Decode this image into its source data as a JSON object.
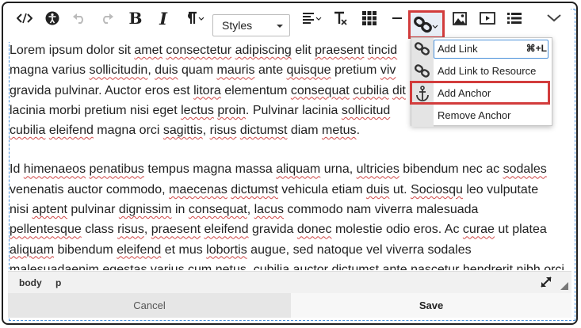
{
  "toolbar": {
    "styles_label": "Styles",
    "icons": [
      "source-code-icon",
      "accessibility-icon",
      "undo-icon",
      "redo-icon",
      "bold-icon",
      "italic-icon",
      "paragraph-icon",
      "align-icon",
      "clear-format-icon",
      "table-icon",
      "horizontal-rule-icon",
      "link-icon",
      "image-icon",
      "media-icon",
      "list-icon",
      "chevron-down-icon"
    ]
  },
  "link_menu": {
    "items": [
      {
        "label": "Add Link",
        "shortcut": "⌘+L"
      },
      {
        "label": "Add Link to Resource"
      },
      {
        "label": "Add Anchor"
      },
      {
        "label": "Remove Anchor"
      }
    ]
  },
  "content": {
    "paragraph_1": [
      "Lorem ipsum dolor sit ",
      "amet",
      " ",
      "consectetur",
      " ",
      "adipiscing",
      " elit ",
      "praesent",
      " ",
      "tincid",
      "magna varius ",
      "sollicitudin",
      ", ",
      "duis",
      " quam ",
      "mauris",
      " ante ",
      "quisque",
      " pretium ",
      "viv",
      "gravida pulvinar. Auctor eros est ",
      "litora",
      " elementum ",
      "consequat",
      " ",
      "cubilia",
      " ",
      "dit",
      "lacinia morbi pretium nisi eget ",
      "lectus",
      " ",
      "proin",
      ". Pulvinar lacinia ",
      "sollicitud",
      "cubilia",
      " ",
      "eleifend",
      " magna orci ",
      "sagittis",
      ", ",
      "risus",
      " ",
      "dictumst",
      " diam ",
      "metus",
      "."
    ],
    "paragraph_2": [
      "Id ",
      "himenaeos",
      " ",
      "penatibus",
      " tempus magna massa ",
      "aliquam",
      " urna, ",
      "ultricies",
      " bibendum nec ac ",
      "sodales",
      "venenatis auctor commodo, ",
      "maecenas",
      " ",
      "dictumst",
      " vehicula etiam ",
      "duis",
      " ut. ",
      "Sociosqu",
      " leo vulputate",
      "nisi ",
      "aptent",
      " pulvinar ",
      "dignissim",
      " in ",
      "consequat",
      ", ",
      "lacus",
      " commodo nam viverra malesuada",
      "pellentesque",
      " class ",
      "risus",
      ", ",
      "praesent",
      " ",
      "eleifend",
      " gravida ",
      "donec",
      " molestie odio eros. Ac ",
      "curae",
      " ut platea",
      "aliquam",
      " bibendum ",
      "eleifend",
      " et mus ",
      "lobortis",
      " augue, sed natoque vel viverra ",
      "sodales",
      " malesuada",
      "enim ",
      "egestas",
      " varius cum ",
      "netus",
      ", ",
      "cubilia",
      " auctor ",
      "dictumst",
      " ante ",
      "nascetur",
      " ",
      "hendrerit",
      " ",
      "nibh",
      " orci tellus."
    ]
  },
  "statusbar": {
    "path": [
      "body",
      "p"
    ]
  },
  "footer": {
    "cancel_label": "Cancel",
    "save_label": "Save"
  },
  "colors": {
    "highlight_border": "#d23c3c",
    "focus_border": "#4a90d9",
    "spell_underline": "#d04848"
  }
}
